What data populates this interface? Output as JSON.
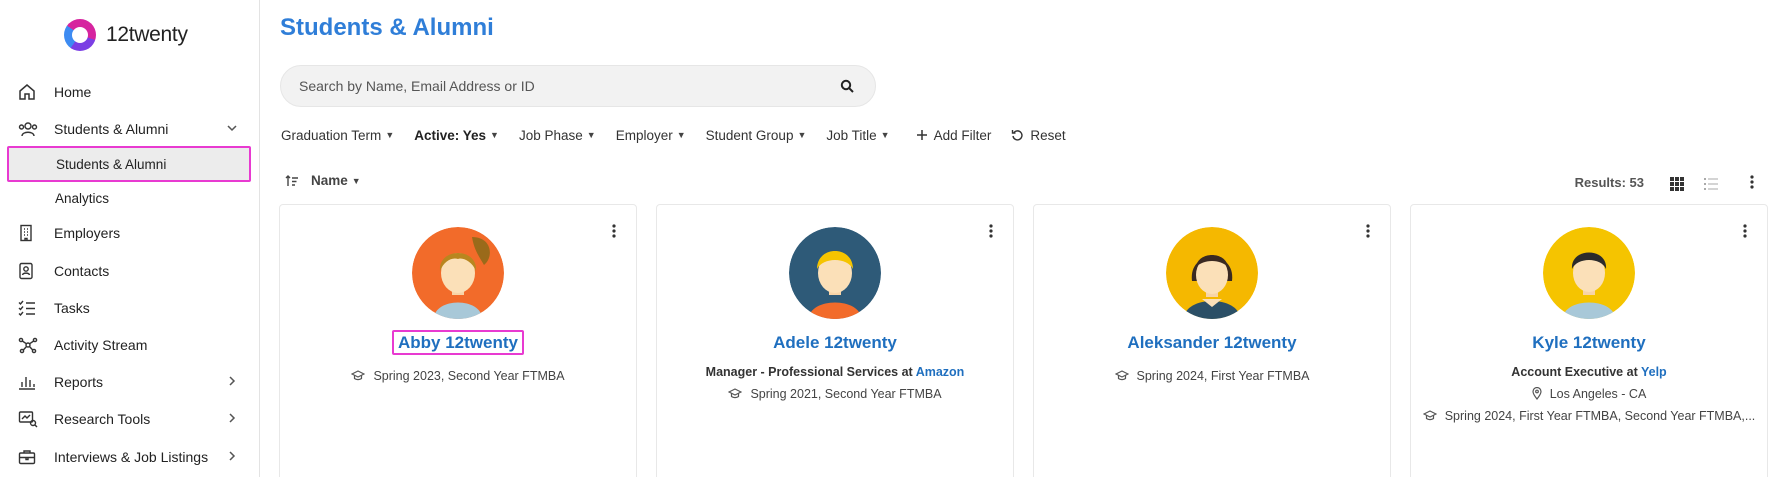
{
  "app": {
    "name": "12twenty"
  },
  "sidebar": {
    "items": [
      {
        "label": "Home",
        "icon": "home-icon"
      },
      {
        "label": "Students & Alumni",
        "icon": "people-icon",
        "expanded": true
      },
      {
        "label": "Employers",
        "icon": "building-icon"
      },
      {
        "label": "Contacts",
        "icon": "contact-card-icon"
      },
      {
        "label": "Tasks",
        "icon": "checklist-icon"
      },
      {
        "label": "Activity Stream",
        "icon": "network-icon"
      },
      {
        "label": "Reports",
        "icon": "bar-chart-icon"
      },
      {
        "label": "Research Tools",
        "icon": "research-icon"
      },
      {
        "label": "Interviews & Job Listings",
        "icon": "briefcase-icon"
      }
    ],
    "subitems": [
      {
        "label": "Students & Alumni",
        "active": true
      },
      {
        "label": "Analytics"
      }
    ]
  },
  "main": {
    "title": "Students & Alumni",
    "search_placeholder": "Search by Name, Email Address or ID",
    "filters": [
      "Graduation Term",
      "Active: Yes",
      "Job Phase",
      "Employer",
      "Student Group",
      "Job Title"
    ],
    "add_filter": "Add Filter",
    "reset": "Reset",
    "sort_label": "Name",
    "results": "Results: 53"
  },
  "cards": [
    {
      "name": "Abby 12twenty",
      "line1": "Spring 2023, Second Year FTMBA",
      "avatar_bg": "#f26b2a"
    },
    {
      "name": "Adele 12twenty",
      "role": "Manager - Professional Services at ",
      "company": "Amazon",
      "line2": "Spring 2021, Second Year FTMBA",
      "avatar_bg": "#2e5a78"
    },
    {
      "name": "Aleksander 12twenty",
      "line1": "Spring 2024, First Year FTMBA",
      "avatar_bg": "#f5b800"
    },
    {
      "name": "Kyle 12twenty",
      "role": "Account Executive at ",
      "company": "Yelp",
      "location": "Los Angeles - CA",
      "line3": "Spring 2024, First Year FTMBA, Second Year FTMBA,...",
      "avatar_bg": "#f5c400"
    }
  ],
  "colors": {
    "accent": "#2f7ed8",
    "link": "#1f6fbf",
    "highlight": "#e83ad1"
  }
}
